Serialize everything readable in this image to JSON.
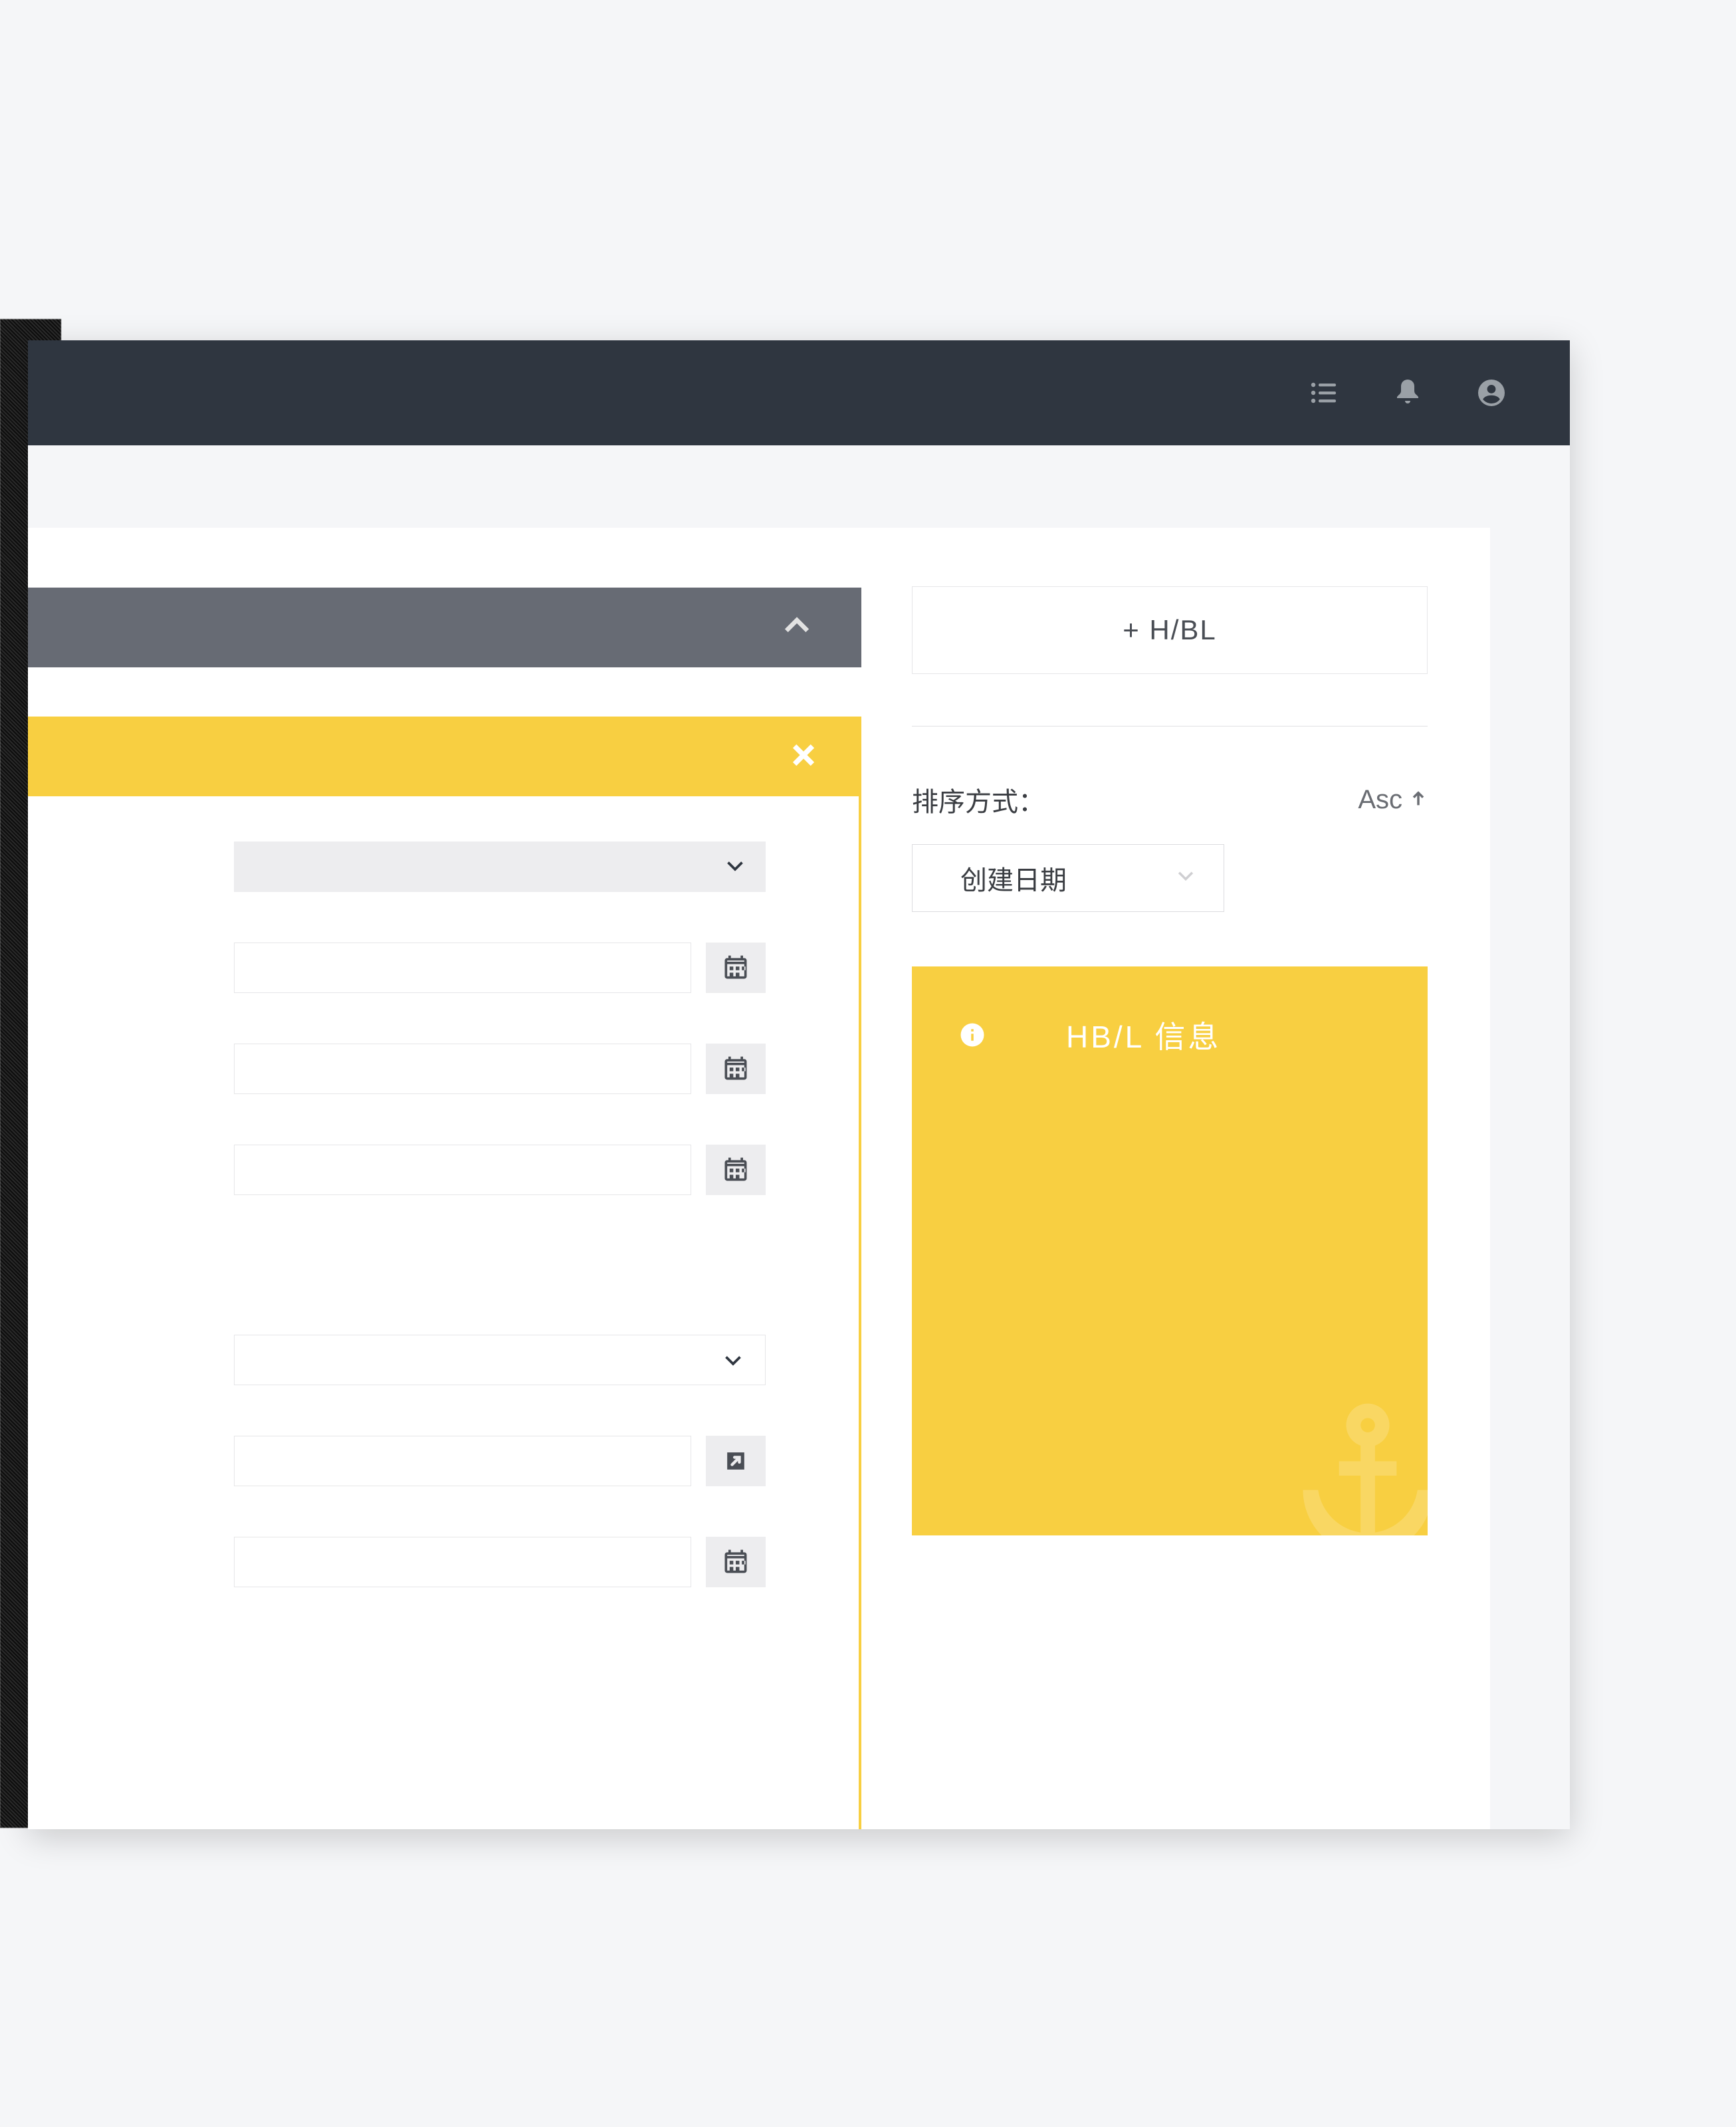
{
  "topbar": {
    "icons": [
      "list-icon",
      "bell-icon",
      "account-icon"
    ]
  },
  "leftPanel": {
    "header": {
      "expanded": true
    },
    "yellow": {
      "closable": true
    }
  },
  "rightPanel": {
    "addButton": "+  H/BL",
    "sortLabel": "排序方式：",
    "sortOrder": "Asc",
    "sortField": "创建日期",
    "card": {
      "title": "HB/L 信息"
    }
  }
}
